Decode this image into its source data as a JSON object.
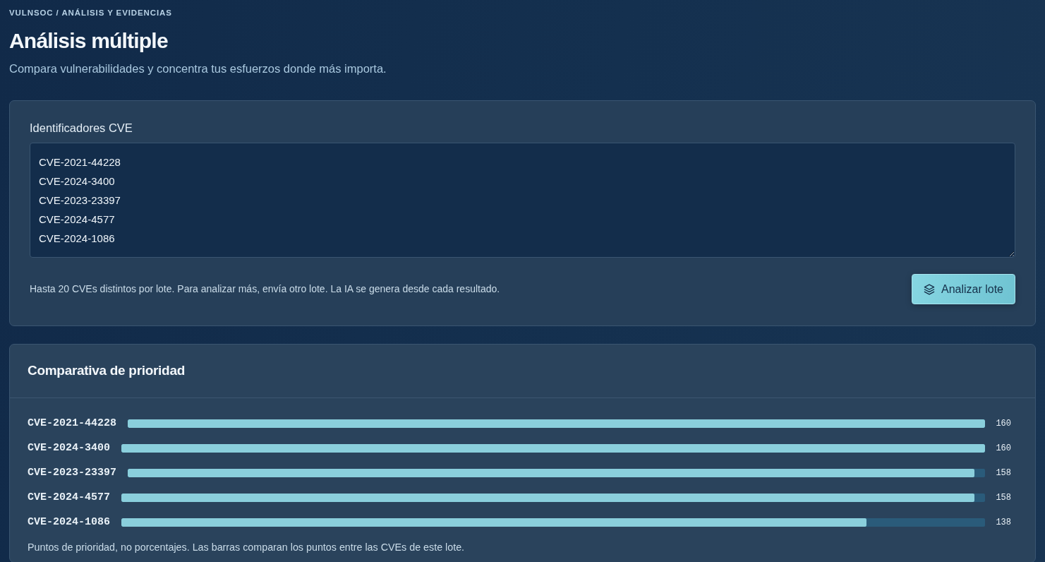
{
  "breadcrumb": "VULNSOC / ANÁLISIS Y EVIDENCIAS",
  "title": "Análisis múltiple",
  "subtitle": "Compara vulnerabilidades y concentra tus esfuerzos donde más importa.",
  "batch_form": {
    "label": "Identificadores CVE",
    "value": [
      "CVE-2021-44228",
      "CVE-2024-3400",
      "CVE-2023-23397",
      "CVE-2024-4577",
      "CVE-2024-1086"
    ],
    "hint": "Hasta 20 CVEs distintos por lote. Para analizar más, envía otro lote. La IA se genera desde cada resultado.",
    "submit_button": "Analizar lote"
  },
  "priority_panel": {
    "title": "Comparativa de prioridad",
    "rows": [
      {
        "cve": "CVE-2021-44228",
        "level": 1,
        "points": "160"
      },
      {
        "cve": "CVE-2024-3400",
        "level": 1,
        "points": "160"
      },
      {
        "cve": "CVE-2023-23397",
        "level": 0.9875,
        "points": "158"
      },
      {
        "cve": "CVE-2024-4577",
        "level": 0.9875,
        "points": "158"
      },
      {
        "cve": "CVE-2024-1086",
        "level": 0.8625,
        "points": "138"
      }
    ],
    "footnote": "Puntos de prioridad, no porcentajes. Las barras comparan los puntos entre las CVEs de este lote."
  }
}
